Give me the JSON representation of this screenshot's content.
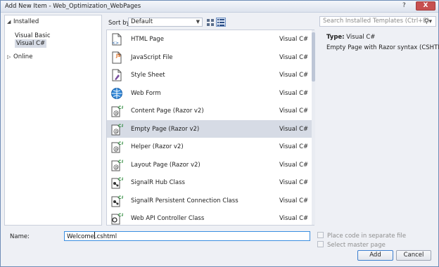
{
  "window": {
    "title": "Add New Item - Web_Optimization_WebPages",
    "help_label": "?",
    "close_label": "X"
  },
  "tree": {
    "installed": "Installed",
    "visual_basic": "Visual Basic",
    "visual_csharp": "Visual C#",
    "online": "Online"
  },
  "toolbar": {
    "sort_label": "Sort by:",
    "sort_value": "Default"
  },
  "search": {
    "placeholder": "Search Installed Templates (Ctrl+E)"
  },
  "templates": [
    {
      "name": "HTML Page",
      "lang": "Visual C#",
      "icon": "html-page-icon"
    },
    {
      "name": "JavaScript File",
      "lang": "Visual C#",
      "icon": "javascript-file-icon"
    },
    {
      "name": "Style Sheet",
      "lang": "Visual C#",
      "icon": "style-sheet-icon"
    },
    {
      "name": "Web Form",
      "lang": "Visual C#",
      "icon": "web-form-icon"
    },
    {
      "name": "Content Page (Razor v2)",
      "lang": "Visual C#",
      "icon": "razor-page-icon"
    },
    {
      "name": "Empty Page (Razor v2)",
      "lang": "Visual C#",
      "icon": "razor-page-icon",
      "selected": true
    },
    {
      "name": "Helper (Razor v2)",
      "lang": "Visual C#",
      "icon": "razor-page-icon"
    },
    {
      "name": "Layout Page (Razor v2)",
      "lang": "Visual C#",
      "icon": "razor-page-icon"
    },
    {
      "name": "SignalR Hub Class",
      "lang": "Visual C#",
      "icon": "signalr-icon"
    },
    {
      "name": "SignalR Persistent Connection Class",
      "lang": "Visual C#",
      "icon": "signalr-icon"
    },
    {
      "name": "Web API Controller Class",
      "lang": "Visual C#",
      "icon": "web-api-icon"
    }
  ],
  "details": {
    "type_label": "Type:",
    "type_value": "Visual C#",
    "description": "Empty Page with Razor syntax (CSHTML)"
  },
  "form": {
    "name_label": "Name:",
    "name_value_before_caret": "Welcome",
    "name_value_after_caret": ".cshtml",
    "place_code_label": "Place code in separate file",
    "select_master_label": "Select master page"
  },
  "buttons": {
    "add": "Add",
    "cancel": "Cancel"
  },
  "colors": {
    "selection": "#d6dbe5",
    "dialog_bg": "#eef0f5",
    "close_button": "#c75050",
    "focus_border": "#3a8ee0"
  }
}
